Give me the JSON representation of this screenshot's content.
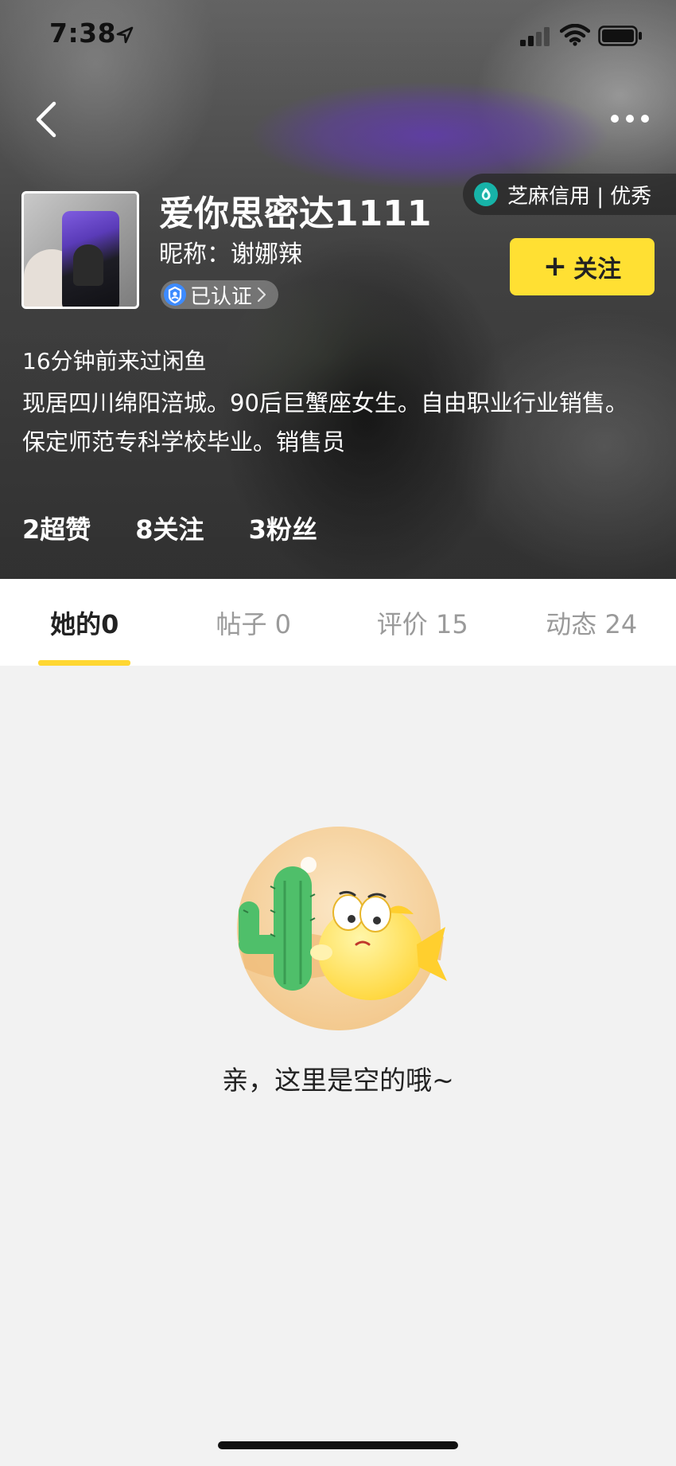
{
  "status_bar": {
    "time": "7:38",
    "icons": [
      "location-arrow-icon",
      "signal-icon",
      "wifi-icon",
      "battery-icon"
    ]
  },
  "nav": {
    "back_icon": "chevron-left-icon",
    "more_icon": "ellipsis-icon"
  },
  "credit": {
    "text": "芝麻信用 | 优秀",
    "icon": "sesame-credit-icon",
    "color": "#17b3a8"
  },
  "profile": {
    "display_name": "爱你思密达1111",
    "nickname": "昵称：谢娜辣",
    "verified_label": "已认证",
    "follow_label": "关注",
    "follow_color": "#ffe033",
    "last_seen": "16分钟前来过闲鱼",
    "bio": "现居四川绵阳涪城。90后巨蟹座女生。自由职业行业销售。保定师范专科学校毕业。销售员"
  },
  "stats": [
    {
      "label": "2超赞"
    },
    {
      "label": "8关注"
    },
    {
      "label": "3粉丝"
    }
  ],
  "tabs": [
    {
      "label": "她的0",
      "active": true
    },
    {
      "label": "帖子 0",
      "active": false
    },
    {
      "label": "评价 15",
      "active": false
    },
    {
      "label": "动态 24",
      "active": false
    }
  ],
  "tab_accent": "#ffd732",
  "empty_state": {
    "text": "亲，这里是空的哦~",
    "illustration": "cactus-and-fish-illustration"
  }
}
